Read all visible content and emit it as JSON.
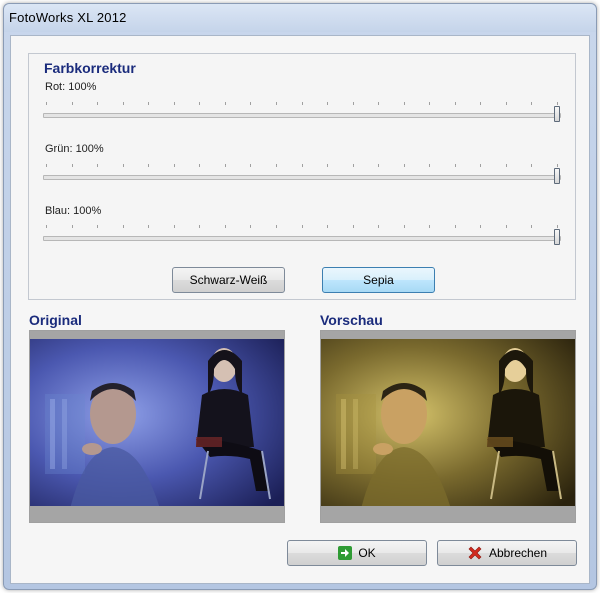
{
  "window": {
    "title": "FotoWorks XL 2012"
  },
  "color_correction": {
    "title": "Farbkorrektur",
    "sliders": [
      {
        "label": "Rot: 100%",
        "value": 100,
        "max": 100
      },
      {
        "label": "Grün: 100%",
        "value": 100,
        "max": 100
      },
      {
        "label": "Blau: 100%",
        "value": 100,
        "max": 100
      }
    ],
    "buttons": {
      "black_white": "Schwarz-Weiß",
      "sepia": "Sepia"
    }
  },
  "previews": {
    "original_title": "Original",
    "preview_title": "Vorschau"
  },
  "footer": {
    "ok_label": "OK",
    "cancel_label": "Abbrechen"
  },
  "colors": {
    "section_title": "#1a2b7c",
    "ok_icon": "#2f9b34",
    "cancel_icon": "#d22a1f"
  }
}
